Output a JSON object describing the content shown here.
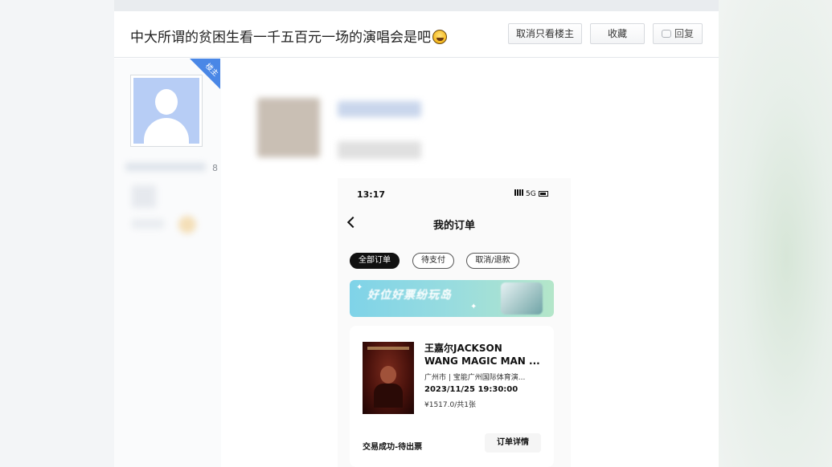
{
  "thread": {
    "title": "中大所谓的贫困生看一千五百元一场的演唱会是吧",
    "title_emoji": "grinning-sweat-emoji",
    "actions": {
      "cancel_owner_only": "取消只看楼主",
      "favorite": "收藏",
      "reply": "回复"
    }
  },
  "post": {
    "owner_badge": "楼主",
    "sidebar_number": "8"
  },
  "phone_screenshot": {
    "status_time": "13:17",
    "network": "5G",
    "page_title": "我的订单",
    "filters": [
      "全部订单",
      "待支付",
      "取消/退款"
    ],
    "active_filter": "全部订单",
    "banner_text": "好位好票纷玩岛",
    "order": {
      "event_name_line1": "王嘉尔JACKSON",
      "event_name_line2": "WANG MAGIC MAN ...",
      "venue": "广州市 | 宝能广州国际体育演...",
      "datetime": "2023/11/25 19:30:00",
      "price": "¥1517.0/共1张",
      "status": "交易成功-待出票",
      "detail_button": "订单详情"
    }
  },
  "colors": {
    "owner_badge": "#4a87e6",
    "avatar_bg": "#b7cdf5",
    "active_chip": "#111111"
  }
}
